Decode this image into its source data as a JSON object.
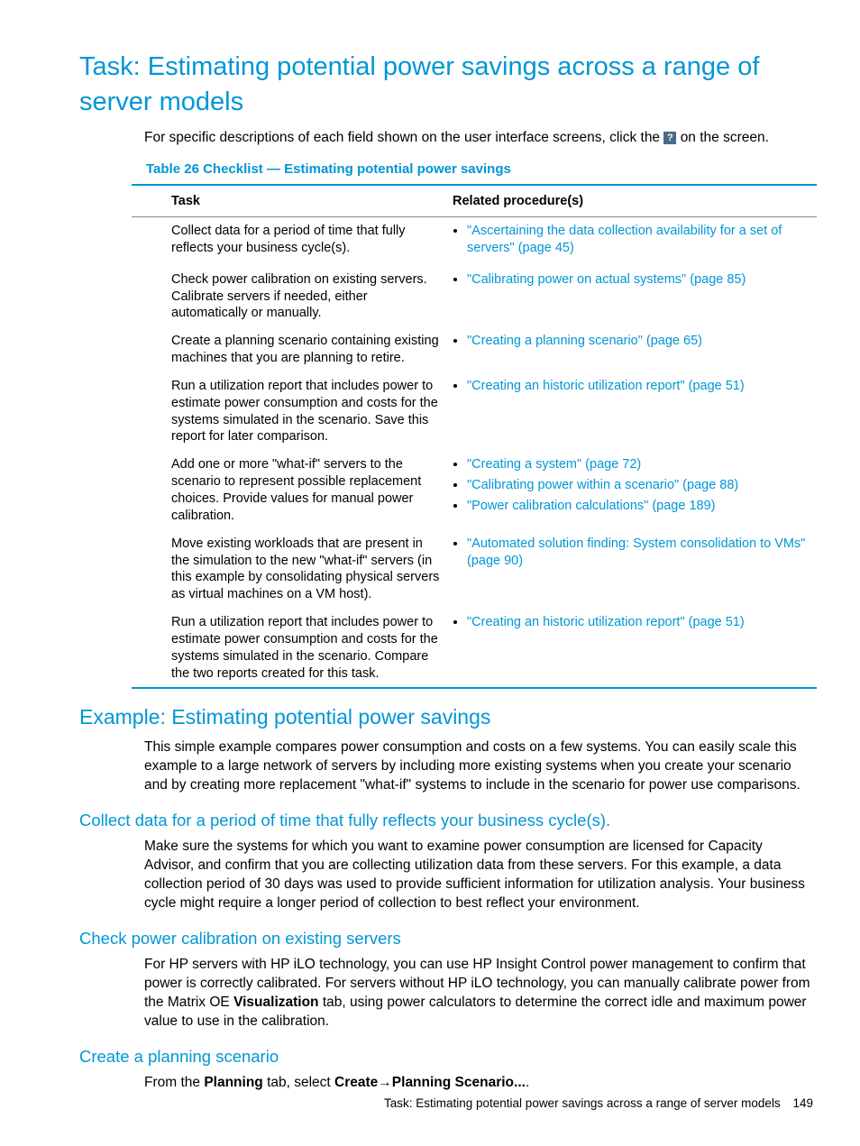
{
  "title": "Task: Estimating potential power savings across a range of server models",
  "intro_a": "For specific descriptions of each field shown on the user interface screens, click the ",
  "intro_b": " on the screen.",
  "help_glyph": "?",
  "table_caption": "Table 26 Checklist — Estimating potential power savings",
  "th_task": "Task",
  "th_proc": "Related procedure(s)",
  "rows": [
    {
      "task": "Collect data for a period of time that fully reflects your business cycle(s).",
      "procs": [
        {
          "l": "\"Ascertaining the data collection availability for a set of servers\" (page 45)"
        }
      ]
    },
    {
      "task": "Check power calibration on existing servers. Calibrate servers if needed, either automatically or manually.",
      "procs": [
        {
          "l": "\"Calibrating power on actual systems\" (page 85)"
        }
      ]
    },
    {
      "task": "Create a planning scenario containing existing machines that you are planning to retire.",
      "procs": [
        {
          "l": "\"Creating a planning scenario\" (page 65)"
        }
      ]
    },
    {
      "task": "Run a utilization report that includes power to estimate power consumption and costs for the systems simulated in the scenario. Save this report for later comparison.",
      "procs": [
        {
          "l": "\"Creating an historic utilization report\" (page 51)"
        }
      ]
    },
    {
      "task": "Add one or more \"what-if\" servers to the scenario to represent possible replacement choices. Provide values for manual power calibration.",
      "procs": [
        {
          "l": "\"Creating a system\" (page 72)"
        },
        {
          "l": "\"Calibrating power within a scenario\" (page 88)"
        },
        {
          "l": "\"Power calibration calculations\" (page 189)"
        }
      ]
    },
    {
      "task": "Move existing workloads that are present in the simulation to the new \"what-if\" servers (in this example by consolidating physical servers as virtual machines on a VM host).",
      "procs": [
        {
          "l": "\"Automated solution finding: System consolidation to VMs\" (page 90)"
        }
      ]
    },
    {
      "task": "Run a utilization report that includes power to estimate power consumption and costs for the systems simulated in the scenario. Compare the two reports created for this task.",
      "procs": [
        {
          "l": "\"Creating an historic utilization report\" (page 51)"
        }
      ]
    }
  ],
  "example_h": "Example: Estimating potential power savings",
  "example_p": "This simple example compares power consumption and costs on a few systems. You can easily scale this example to a large network of servers by including more existing systems when you create your scenario and by creating more replacement \"what-if\" systems to include in the scenario for power use comparisons.",
  "sec1_h": "Collect data for a period of time that fully reflects your business cycle(s).",
  "sec1_p": "Make sure the systems for which you want to examine power consumption are licensed for Capacity Advisor, and confirm that you are collecting utilization data from these servers. For this example, a data collection period of 30 days was used to provide sufficient information for utilization analysis. Your business cycle might require a longer period of collection to best reflect your environment.",
  "sec2_h": "Check power calibration on existing servers",
  "sec2_p_a": "For HP servers with HP iLO technology, you can use HP Insight Control power management to confirm that power is correctly calibrated. For servers without HP iLO technology, you can manually calibrate power from the Matrix OE ",
  "sec2_bold": "Visualization",
  "sec2_p_b": " tab, using power calculators to determine the correct idle and maximum power value to use in the calibration.",
  "sec3_h": "Create a planning scenario",
  "sec3_a": "From the ",
  "sec3_b1": "Planning",
  "sec3_b": " tab, select ",
  "sec3_b2": "Create",
  "sec3_arrow": "→",
  "sec3_b3": "Planning Scenario...",
  "sec3_c": ".",
  "footer_text": "Task: Estimating potential power savings across a range of server models",
  "page_number": "149"
}
